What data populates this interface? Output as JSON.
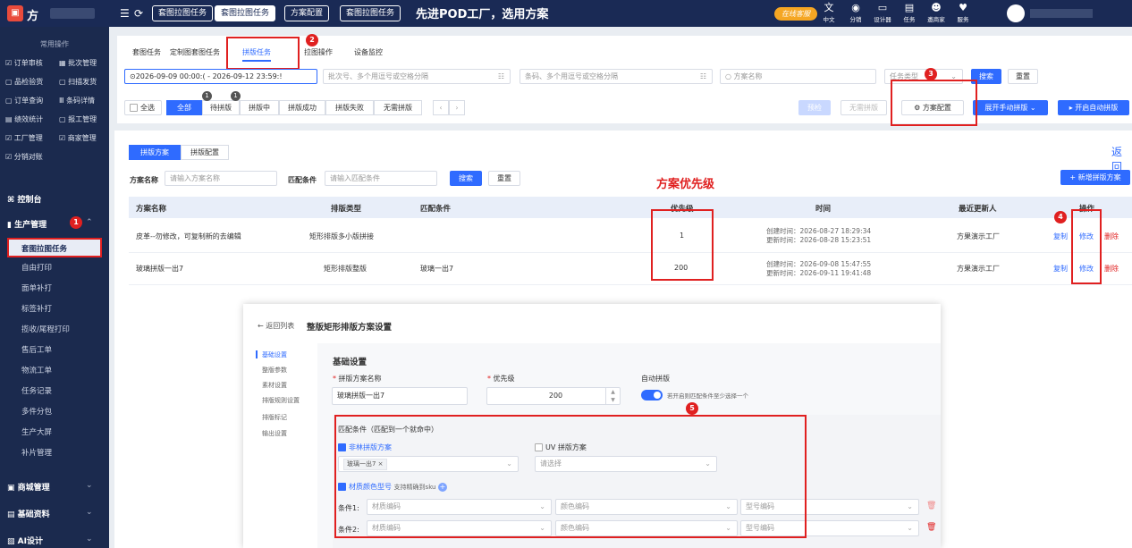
{
  "topbar": {
    "logo_text": "方",
    "tabs": [
      "套图拉图任务",
      "套图拉图任务",
      "方案配置",
      "套图拉图任务"
    ],
    "slogan": "先进POD工厂，选用方案",
    "online_badge": "在线客服",
    "right_items": [
      {
        "icon": "translate-icon",
        "label": "中文"
      },
      {
        "icon": "share-icon",
        "label": "分销"
      },
      {
        "icon": "designer-icon",
        "label": "设计器"
      },
      {
        "icon": "task-icon",
        "label": "任务"
      },
      {
        "icon": "invite-icon",
        "label": "邀商家"
      },
      {
        "icon": "service-icon",
        "label": "服务"
      }
    ]
  },
  "sidebar": {
    "common_header": "常用操作",
    "shortcuts": [
      [
        "订单审核",
        "批次管理"
      ],
      [
        "品检验货",
        "扫描发货"
      ],
      [
        "订单查询",
        "条码详情"
      ],
      [
        "绩效统计",
        "报工管理"
      ],
      [
        "工厂管理",
        "商家管理"
      ],
      [
        "分销对账",
        ""
      ]
    ],
    "sections": {
      "console": "控制台",
      "production": "生产管理",
      "mall": "商城管理",
      "basic": "基础资料",
      "ai": "AI设计"
    },
    "production_items": [
      "套图拉图任务",
      "自由打印",
      "面单补打",
      "标签补打",
      "揽收/尾程打印",
      "售后工单",
      "物流工单",
      "任务记录",
      "多件分包",
      "生产大屏",
      "补片管理"
    ]
  },
  "subtabs": [
    "套图任务",
    "定制图套图任务",
    "拼版任务",
    "拉图操作",
    "设备监控"
  ],
  "filters": {
    "date_range": "⊙2026-09-09 00:00:( - 2026-09-12 23:59:!",
    "batch_placeholder": "批次号、多个用逗号或空格分隔",
    "barcode_placeholder": "条码、多个用逗号或空格分隔",
    "scheme_placeholder": "方案名称",
    "task_type_placeholder": "任务类型",
    "search": "搜索",
    "reset": "重置"
  },
  "status_tabs": {
    "select_all": "全选",
    "tabs": [
      "全部",
      "待拼版",
      "拼版中",
      "拼版成功",
      "拼版失败",
      "无需拼版"
    ],
    "badges": [
      "1",
      "1"
    ],
    "precheck": "预检",
    "no_need": "无需拼版",
    "scheme_config": "方案配置",
    "manual": "展开手动拼版",
    "auto": "开启自动拼版"
  },
  "scheme_page": {
    "tabs": [
      "拼版方案",
      "拼版配置"
    ],
    "back": "返回",
    "name_label": "方案名称",
    "name_placeholder": "请输入方案名称",
    "cond_label": "匹配条件",
    "cond_placeholder": "请输入匹配条件",
    "search": "搜索",
    "reset": "重置",
    "new_button": "+ 新增拼版方案",
    "annotation": "方案优先级",
    "columns": [
      "方案名称",
      "排版类型",
      "匹配条件",
      "优先级",
      "时间",
      "最近更新人",
      "操作"
    ],
    "rows": [
      {
        "name": "皮革--勿修改，可复制新的去编辑",
        "type": "矩形排版多小版拼接",
        "cond": "",
        "priority": "1",
        "created": "创建时间：2026-08-27 18:29:34",
        "updated": "更新时间：2026-08-28 15:23:51",
        "updater": "方果演示工厂"
      },
      {
        "name": "玻璃拼版一出7",
        "type": "矩形排版整版",
        "cond": "玻璃一出7",
        "priority": "200",
        "created": "创建时间：2026-09-08 15:47:55",
        "updated": "更新时间：2026-09-11 19:41:48",
        "updater": "方果演示工厂"
      }
    ],
    "actions": [
      "复制",
      "修改",
      "删除"
    ]
  },
  "modal": {
    "back": "← 返回列表",
    "title": "整版矩形排版方案设置",
    "side": [
      "基础设置",
      "整版参数",
      "素材设置",
      "排版规则设置",
      "排版标记",
      "输出设置"
    ],
    "section": "基础设置",
    "name_label": "拼版方案名称",
    "name_value": "玻璃拼版一出7",
    "priority_label": "优先级",
    "priority_value": "200",
    "auto_label": "自动拼版",
    "auto_hint": "若开启则匹配条件至少选择一个",
    "match_title": "匹配条件（匹配到一个就命中）",
    "non_wood": "非林拼版方案",
    "non_wood_tag": "玻璃一出7 ×",
    "uv": "UV 拼版方案",
    "uv_placeholder": "请选择",
    "material_check": "材质颜色型号",
    "material_hint": "支持精确到sku",
    "cond1": "条件1:",
    "cond2": "条件2:",
    "material_ph": "材质编码",
    "color_ph": "颜色编码",
    "model_ph": "型号编码"
  },
  "markers": [
    "1",
    "2",
    "3",
    "4",
    "5"
  ],
  "colors": {
    "accent": "#2f6bff",
    "annotation": "#e02020",
    "nav": "#1b2a4e"
  }
}
